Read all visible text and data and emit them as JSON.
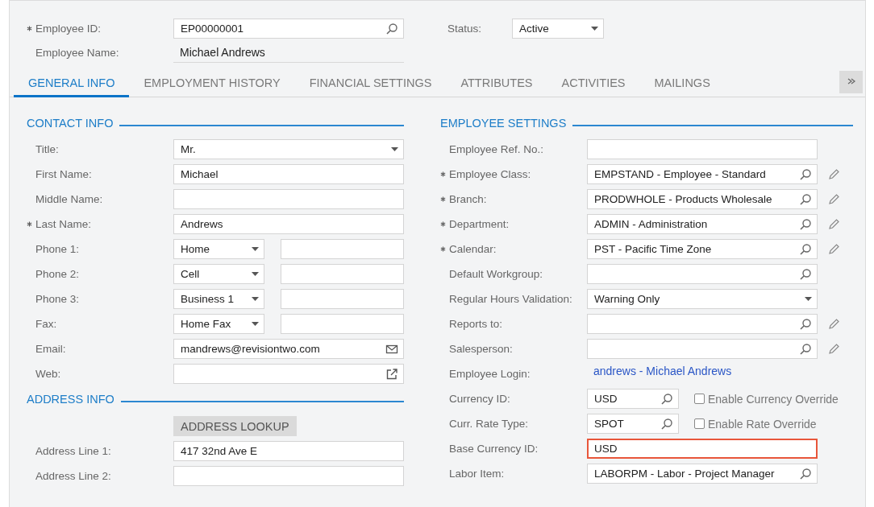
{
  "header": {
    "employee_id": {
      "label": "Employee ID:",
      "required": true,
      "value": "EP00000001"
    },
    "employee_name": {
      "label": "Employee Name:",
      "required": false,
      "value": "Michael Andrews"
    },
    "status": {
      "label": "Status:",
      "value": "Active"
    }
  },
  "tabs": [
    {
      "label": "GENERAL INFO",
      "selected": true
    },
    {
      "label": "EMPLOYMENT HISTORY",
      "selected": false
    },
    {
      "label": "FINANCIAL SETTINGS",
      "selected": false
    },
    {
      "label": "ATTRIBUTES",
      "selected": false
    },
    {
      "label": "ACTIVITIES",
      "selected": false
    },
    {
      "label": "MAILINGS",
      "selected": false
    }
  ],
  "contact_info": {
    "title": "CONTACT INFO",
    "fields": [
      {
        "kind": "select",
        "label": "Title:",
        "required": false,
        "value": "Mr."
      },
      {
        "kind": "text",
        "label": "First Name:",
        "required": false,
        "invalid": false,
        "value": "Michael"
      },
      {
        "kind": "text",
        "label": "Middle Name:",
        "required": false,
        "invalid": false
      },
      {
        "kind": "text",
        "label": "Last Name:",
        "required": true,
        "invalid": false,
        "value": "Andrews"
      },
      {
        "kind": "phone",
        "label": "Phone 1:",
        "required": false,
        "type": "Home"
      },
      {
        "kind": "phone",
        "label": "Phone 2:",
        "required": false,
        "type": "Cell"
      },
      {
        "kind": "phone",
        "label": "Phone 3:",
        "required": false,
        "type": "Business 1"
      },
      {
        "kind": "phone",
        "label": "Fax:",
        "required": false,
        "type": "Home Fax"
      },
      {
        "kind": "email",
        "label": "Email:",
        "required": false,
        "value": "mandrews@revisiontwo.com"
      },
      {
        "kind": "web",
        "label": "Web:",
        "required": false
      }
    ]
  },
  "address_info": {
    "title": "ADDRESS INFO",
    "lookup_button": "ADDRESS LOOKUP",
    "fields": [
      {
        "kind": "text",
        "label": "Address Line 1:",
        "required": false,
        "invalid": false,
        "value": "417 32nd Ave E"
      },
      {
        "kind": "text",
        "label": "Address Line 2:",
        "required": false,
        "invalid": false
      }
    ]
  },
  "employee_settings": {
    "title": "EMPLOYEE SETTINGS",
    "fields": [
      {
        "kind": "text",
        "label": "Employee Ref. No.:",
        "required": false,
        "invalid": false
      },
      {
        "kind": "lookup",
        "label": "Employee Class:",
        "required": true,
        "editable": true,
        "value": "EMPSTAND - Employee - Standard"
      },
      {
        "kind": "lookup",
        "label": "Branch:",
        "required": true,
        "editable": true,
        "value": "PRODWHOLE - Products Wholesale"
      },
      {
        "kind": "lookup",
        "label": "Department:",
        "required": true,
        "editable": true,
        "value": "ADMIN - Administration"
      },
      {
        "kind": "lookup",
        "label": "Calendar:",
        "required": true,
        "editable": true,
        "value": "PST - Pacific Time Zone"
      },
      {
        "kind": "lookup",
        "label": "Default Workgroup:",
        "required": false,
        "editable": false
      },
      {
        "kind": "select",
        "label": "Regular Hours Validation:",
        "required": false,
        "value": "Warning Only"
      },
      {
        "kind": "lookup",
        "label": "Reports to:",
        "required": false,
        "editable": true
      },
      {
        "kind": "lookup",
        "label": "Salesperson:",
        "required": false,
        "editable": true
      },
      {
        "kind": "link",
        "label": "Employee Login:",
        "required": false,
        "value": "andrews - Michael Andrews"
      },
      {
        "kind": "lookup-check",
        "label": "Currency ID:",
        "required": false,
        "value": "USD",
        "checkbox": {
          "label": "Enable Currency Override",
          "checked": false
        }
      },
      {
        "kind": "lookup-check",
        "label": "Curr. Rate Type:",
        "required": false,
        "value": "SPOT",
        "checkbox": {
          "label": "Enable Rate Override",
          "checked": false
        }
      },
      {
        "kind": "text",
        "label": "Base Currency ID:",
        "required": false,
        "invalid": true,
        "value": "USD"
      },
      {
        "kind": "lookup",
        "label": "Labor Item:",
        "required": false,
        "editable": false,
        "value": "LABORPM - Labor - Project Manager"
      }
    ]
  }
}
